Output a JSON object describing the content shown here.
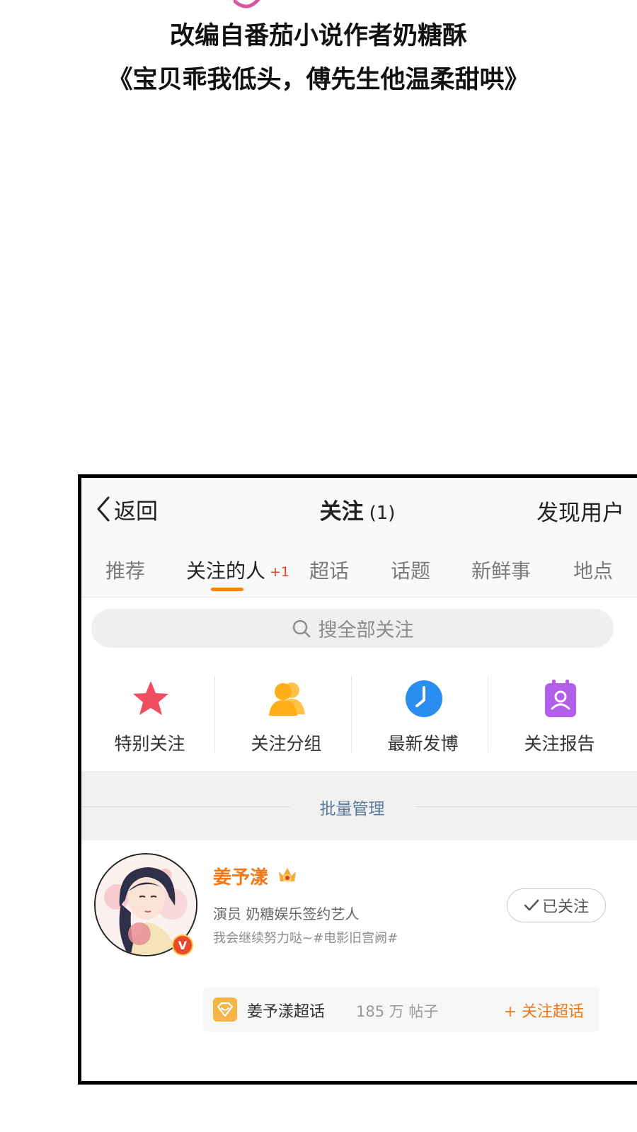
{
  "credit": {
    "line1": "改编自番茄小说作者奶糖酥",
    "line2": "《宝贝乖我低头，傅先生他温柔甜哄》"
  },
  "navbar": {
    "back_label": "返回",
    "title": "关注",
    "count": "(1)",
    "discover_label": "发现用户"
  },
  "tabs": [
    {
      "label": "推荐"
    },
    {
      "label": "关注的人",
      "badge": "+1",
      "active": true
    },
    {
      "label": "超话"
    },
    {
      "label": "话题"
    },
    {
      "label": "新鲜事"
    },
    {
      "label": "地点"
    }
  ],
  "search": {
    "placeholder": "搜全部关注",
    "icon": "search-icon"
  },
  "quick_actions": [
    {
      "label": "特别关注",
      "icon": "star-icon",
      "color": "#f04d61"
    },
    {
      "label": "关注分组",
      "icon": "group-icon",
      "color": "#ffb020"
    },
    {
      "label": "最新发博",
      "icon": "clock-icon",
      "color": "#2a8ef0"
    },
    {
      "label": "关注报告",
      "icon": "report-icon",
      "color": "#b35ee8"
    }
  ],
  "batch_manage": "批量管理",
  "user": {
    "name": "姜予漾",
    "desc": "演员  奶糖娱乐签约艺人",
    "signature": "我会继续努力哒~#电影旧宫阙#",
    "follow_status": "已关注",
    "verified_badge": "V",
    "name_color": "#f07919"
  },
  "super_topic": {
    "name": "姜予漾超话",
    "count": "185 万 帖子",
    "follow_label": "+ 关注超话"
  },
  "colors": {
    "accent": "#ff8200",
    "link": "#5b7a9c"
  }
}
